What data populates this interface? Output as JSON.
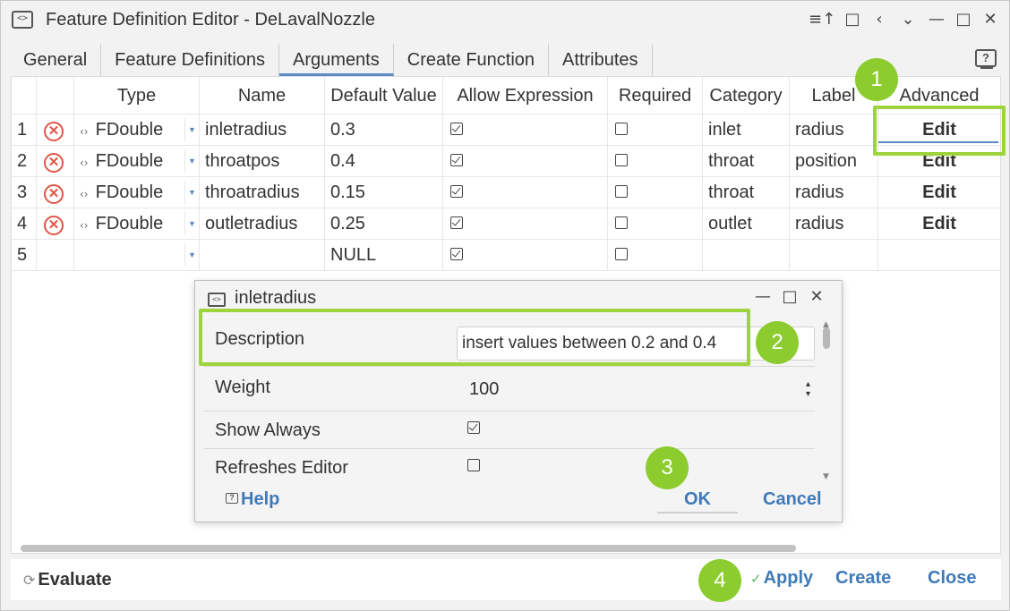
{
  "window": {
    "title": "Feature Definition Editor - DeLavalNozzle",
    "title_icon": "<>",
    "controls": [
      "≡↑",
      "□",
      "‹",
      "⌄",
      "—",
      "□",
      "✕"
    ]
  },
  "tabs": [
    "General",
    "Feature Definitions",
    "Arguments",
    "Create Function",
    "Attributes"
  ],
  "active_tab": "Arguments",
  "help_icon": "?",
  "grid": {
    "headers": [
      "",
      "",
      "Type",
      "Name",
      "Default Value",
      "Allow Expression",
      "Required",
      "Category",
      "Label",
      "Advanced"
    ],
    "rows": [
      {
        "num": "1",
        "type": "FDouble",
        "name": "inletradius",
        "default": "0.3",
        "allow_expr": true,
        "required": false,
        "category": "inlet",
        "label": "radius",
        "advanced": "Edit"
      },
      {
        "num": "2",
        "type": "FDouble",
        "name": "throatpos",
        "default": "0.4",
        "allow_expr": true,
        "required": false,
        "category": "throat",
        "label": "position",
        "advanced": "Edit"
      },
      {
        "num": "3",
        "type": "FDouble",
        "name": "throatradius",
        "default": "0.15",
        "allow_expr": true,
        "required": false,
        "category": "throat",
        "label": "radius",
        "advanced": "Edit"
      },
      {
        "num": "4",
        "type": "FDouble",
        "name": "outletradius",
        "default": "0.25",
        "allow_expr": true,
        "required": false,
        "category": "outlet",
        "label": "radius",
        "advanced": "Edit"
      },
      {
        "num": "5",
        "type": "",
        "name": "",
        "default": "NULL",
        "allow_expr": true,
        "required": false,
        "category": "",
        "label": "",
        "advanced": ""
      }
    ]
  },
  "dialog": {
    "title": "inletradius",
    "description_label": "Description",
    "description_value": "insert values between 0.2 and 0.4",
    "weight_label": "Weight",
    "weight_value": "100",
    "show_always_label": "Show Always",
    "show_always": true,
    "refreshes_label": "Refreshes Editor",
    "refreshes": false,
    "help": "Help",
    "ok": "OK",
    "cancel": "Cancel"
  },
  "bottom": {
    "evaluate": "Evaluate",
    "apply": "Apply",
    "create": "Create",
    "close": "Close"
  },
  "annotations": {
    "badges": [
      "1",
      "2",
      "3",
      "4"
    ],
    "highlight_color": "#9dd43b",
    "badge_color": "#8ccc2f"
  },
  "colors": {
    "link": "#3f7ab8",
    "delete": "#e05548",
    "tab_underline": "#5b8ac4"
  }
}
